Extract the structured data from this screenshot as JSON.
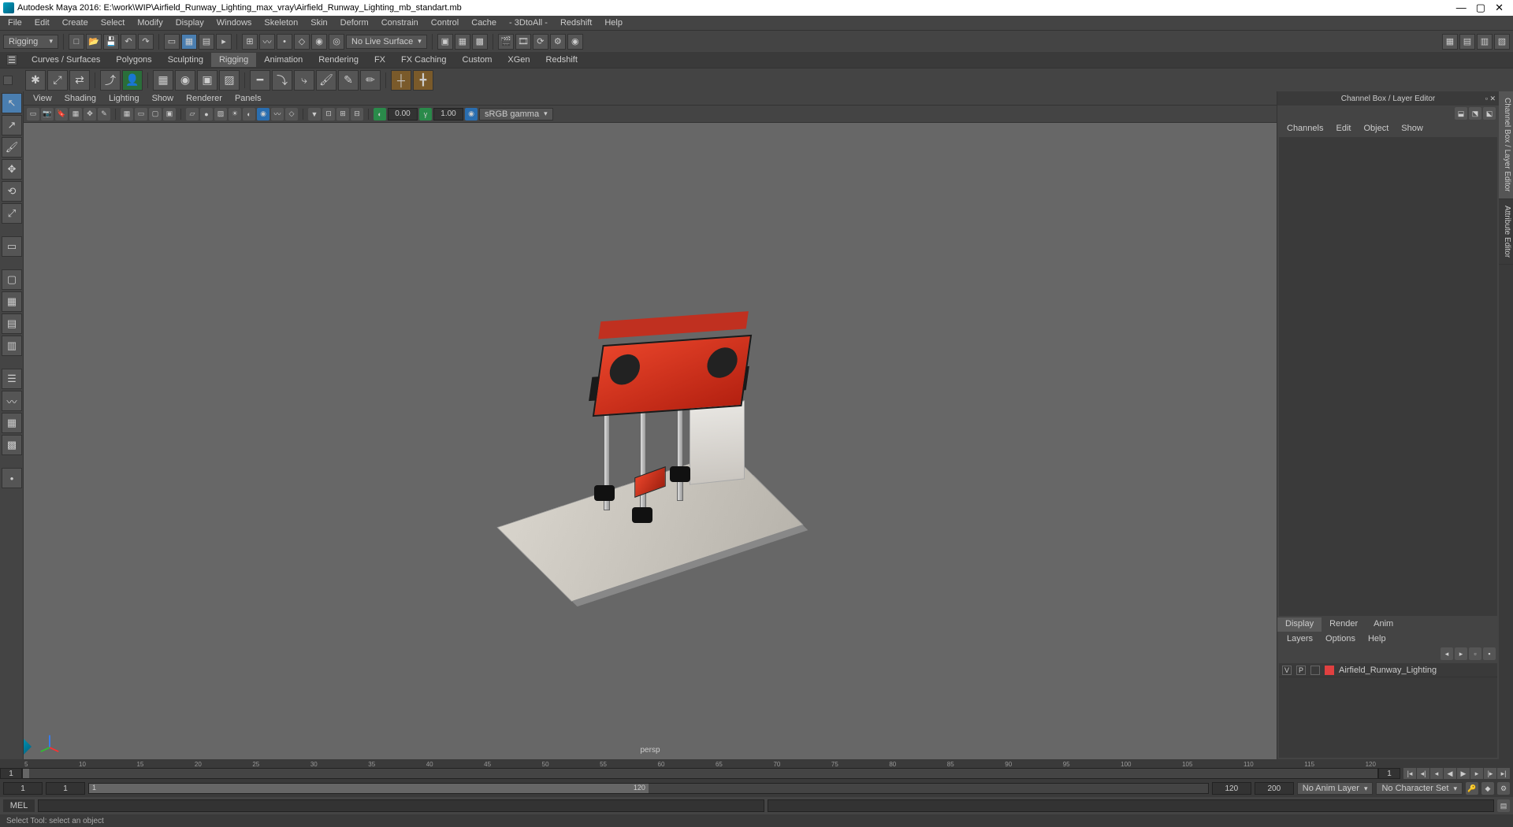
{
  "window": {
    "title": "Autodesk Maya 2016: E:\\work\\WIP\\Airfield_Runway_Lighting_max_vray\\Airfield_Runway_Lighting_mb_standart.mb",
    "min": "—",
    "max": "▢",
    "close": "✕"
  },
  "menubar": [
    "File",
    "Edit",
    "Create",
    "Select",
    "Modify",
    "Display",
    "Windows",
    "Skeleton",
    "Skin",
    "Deform",
    "Constrain",
    "Control",
    "Cache",
    "- 3DtoAll -",
    "Redshift",
    "Help"
  ],
  "workspace_dropdown": "Rigging",
  "live_surface": "No Live Surface",
  "shelf_tabs": [
    "Curves / Surfaces",
    "Polygons",
    "Sculpting",
    "Rigging",
    "Animation",
    "Rendering",
    "FX",
    "FX Caching",
    "Custom",
    "XGen",
    "Redshift"
  ],
  "viewport_menu": [
    "View",
    "Shading",
    "Lighting",
    "Show",
    "Renderer",
    "Panels"
  ],
  "viewport": {
    "near": "0.00",
    "far": "1.00",
    "colorspace": "sRGB gamma",
    "camera": "persp"
  },
  "channel_box": {
    "title": "Channel Box / Layer Editor",
    "menu": [
      "Channels",
      "Edit",
      "Object",
      "Show"
    ]
  },
  "layer_editor": {
    "tabs": [
      "Display",
      "Render",
      "Anim"
    ],
    "menu": [
      "Layers",
      "Options",
      "Help"
    ],
    "layer": {
      "v": "V",
      "p": "P",
      "name": "Airfield_Runway_Lighting"
    }
  },
  "right_tabs": [
    "Channel Box / Layer Editor",
    "Attribute Editor"
  ],
  "timeline": {
    "start_display": "1",
    "end_display": "1",
    "ticks": [
      "5",
      "10",
      "15",
      "20",
      "25",
      "30",
      "35",
      "40",
      "45",
      "50",
      "55",
      "60",
      "65",
      "70",
      "75",
      "80",
      "85",
      "90",
      "95",
      "100",
      "105",
      "110",
      "115",
      "120"
    ],
    "range_start": "1",
    "range_end": "1",
    "range_in": "1",
    "range_out": "120",
    "playback_end": "120",
    "frame": "200",
    "anim_layer": "No Anim Layer",
    "char_set": "No Character Set"
  },
  "command": {
    "lang": "MEL"
  },
  "status": "Select Tool: select an object"
}
